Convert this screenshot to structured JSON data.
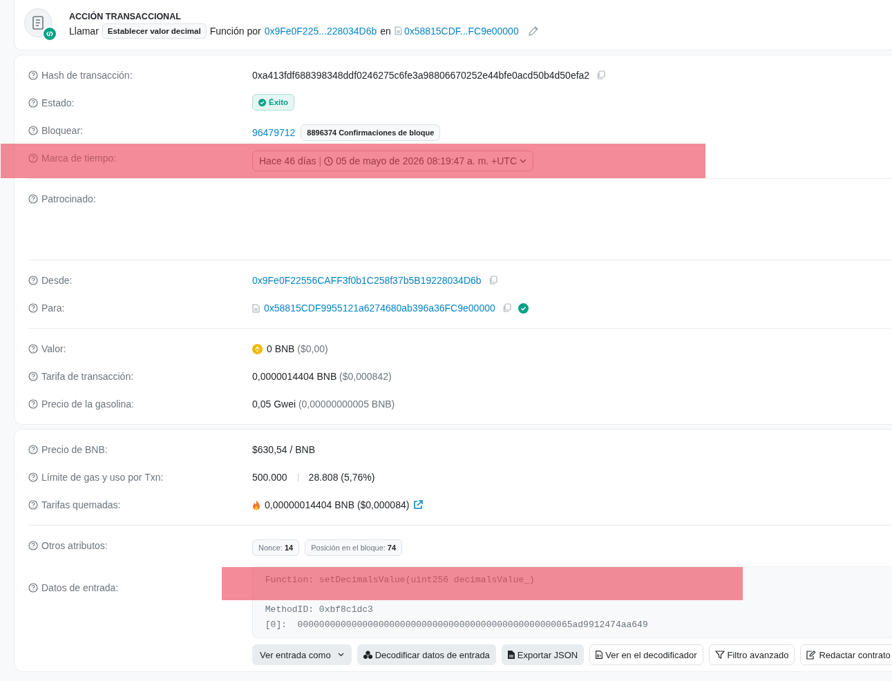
{
  "header": {
    "title": "ACCIÓN TRANSACCIONAL",
    "verb": "Llamar",
    "method": "Establecer valor decimal",
    "by_label": "Función por",
    "from": "0x9Fe0F225...228034D6b",
    "in_label": "en",
    "to": "0x58815CDF...FC9e00000"
  },
  "sections": [
    {
      "groups": [
        {
          "rows": [
            {
              "kind": "hash",
              "label": "Hash de transacción:",
              "value": "0xa413fdf688398348ddf0246275c6fe3a98806670252e44bfe0acd50b4d50efa2",
              "highlighted": false
            },
            {
              "kind": "status",
              "label": "Estado:",
              "value": "Éxito",
              "highlighted": false
            },
            {
              "kind": "block",
              "label": "Bloquear:",
              "value": "96479712",
              "badge": "8896374 Confirmaciones de bloque",
              "highlighted": false
            },
            {
              "kind": "timestamp",
              "label": "Marca de tiempo:",
              "value": "Hace 46 días",
              "separator": "|",
              "date": "05 de mayo de 2026 08:19:47 a. m. +UTC",
              "highlighted": true
            }
          ]
        },
        {
          "rows": [
            {
              "kind": "empty",
              "label": "Patrocinado:",
              "highlighted": false
            }
          ]
        },
        {
          "rows": [
            {
              "kind": "address",
              "label": "Desde:",
              "value": "0x9Fe0F22556CAFF3f0b1C258f37b5B19228034D6b",
              "highlighted": false
            },
            {
              "kind": "contract",
              "label": "Para:",
              "value": "0x58815CDF9955121a6274680ab396a36FC9e00000",
              "verified": true,
              "highlighted": false
            }
          ]
        },
        {
          "rows": [
            {
              "kind": "amount",
              "label": "Valor:",
              "value": "0 BNB",
              "muted": "($0,00)",
              "highlighted": false
            },
            {
              "kind": "plain",
              "label": "Tarifa de transacción:",
              "value": "0,0000014404 BNB",
              "muted": "($0,000842)",
              "highlighted": false
            },
            {
              "kind": "plain",
              "label": "Precio de la gasolina:",
              "value": "0,05 Gwei",
              "muted": "(0,00000000005 BNB)",
              "highlighted": false
            }
          ]
        }
      ]
    },
    {
      "groups": [
        {
          "rows": [
            {
              "kind": "plain",
              "label": "Precio de BNB:",
              "value": "$630,54 / BNB",
              "highlighted": false
            },
            {
              "kind": "gas",
              "label": "Límite de gas y uso por Txn:",
              "value": "500.000",
              "usage": "28.808 (5,76%)",
              "highlighted": false
            },
            {
              "kind": "burnt",
              "label": "Tarifas quemadas:",
              "value": "0,00000014404 BNB ($0,000084)",
              "highlighted": false
            }
          ]
        },
        {
          "rows": [
            {
              "kind": "tags",
              "label": "Otros atributos:",
              "tags": [
                {
                  "name": "Nonce:",
                  "value": "14"
                },
                {
                  "name": "Posición en el bloque:",
                  "value": "74"
                }
              ],
              "highlighted": false
            },
            {
              "kind": "input",
              "label": "Datos de entrada:",
              "highlighted": false,
              "lines": [
                {
                  "text": "Function: setDecimalsValue(uint256 decimalsValue_)",
                  "highlighted": true
                },
                {
                  "highlighted": false
                },
                {
                  "text": "MethodID: 0xbf8c1dc3",
                  "highlighted": false
                },
                {
                  "text": "[0]:  000000000000000000000000000000000000000000000000065ad9912474aa649",
                  "highlighted": false
                }
              ],
              "buttons": [
                {
                  "kind": "dropdown",
                  "label": "Ver entrada como"
                },
                {
                  "kind": "decode",
                  "label": "Decodificar datos de entrada"
                },
                {
                  "kind": "export",
                  "label": "Exportar JSON"
                },
                {
                  "kind": "decoder",
                  "label": "Ver en el decodificador"
                },
                {
                  "kind": "filter",
                  "label": "Filtro avanzado"
                },
                {
                  "kind": "write",
                  "label": "Redactar contrato"
                }
              ]
            }
          ]
        }
      ]
    }
  ]
}
